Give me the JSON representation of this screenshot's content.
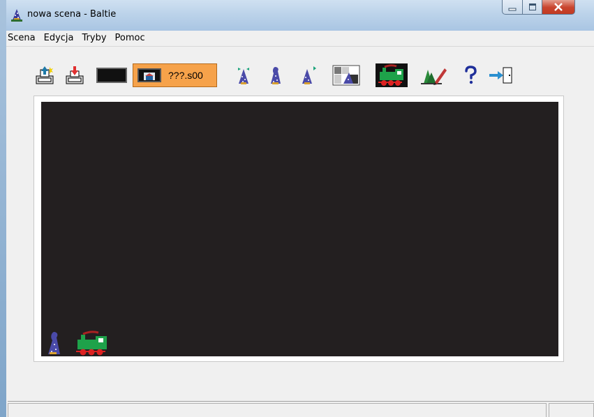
{
  "window": {
    "title": "nowa scena - Baltie"
  },
  "window_controls": {
    "minimize": "–",
    "maximize": "☐",
    "close": "X"
  },
  "menu": [
    "Scena",
    "Edycja",
    "Tryby",
    "Pomoc"
  ],
  "toolbar": {
    "filename": "???.s00",
    "buttons": [
      "new-scene-icon",
      "load-scene-icon",
      "black-screen-icon",
      "scene-file-icon",
      "wizard-icon",
      "wizard-walking-icon",
      "wizard-magic-icon",
      "builder-icon",
      "train-icon",
      "painting-icon",
      "help-icon",
      "exit-icon"
    ],
    "accent": "#f6a24a"
  },
  "stage": {
    "background": "#231f20",
    "objects": [
      "wizard",
      "train"
    ]
  }
}
